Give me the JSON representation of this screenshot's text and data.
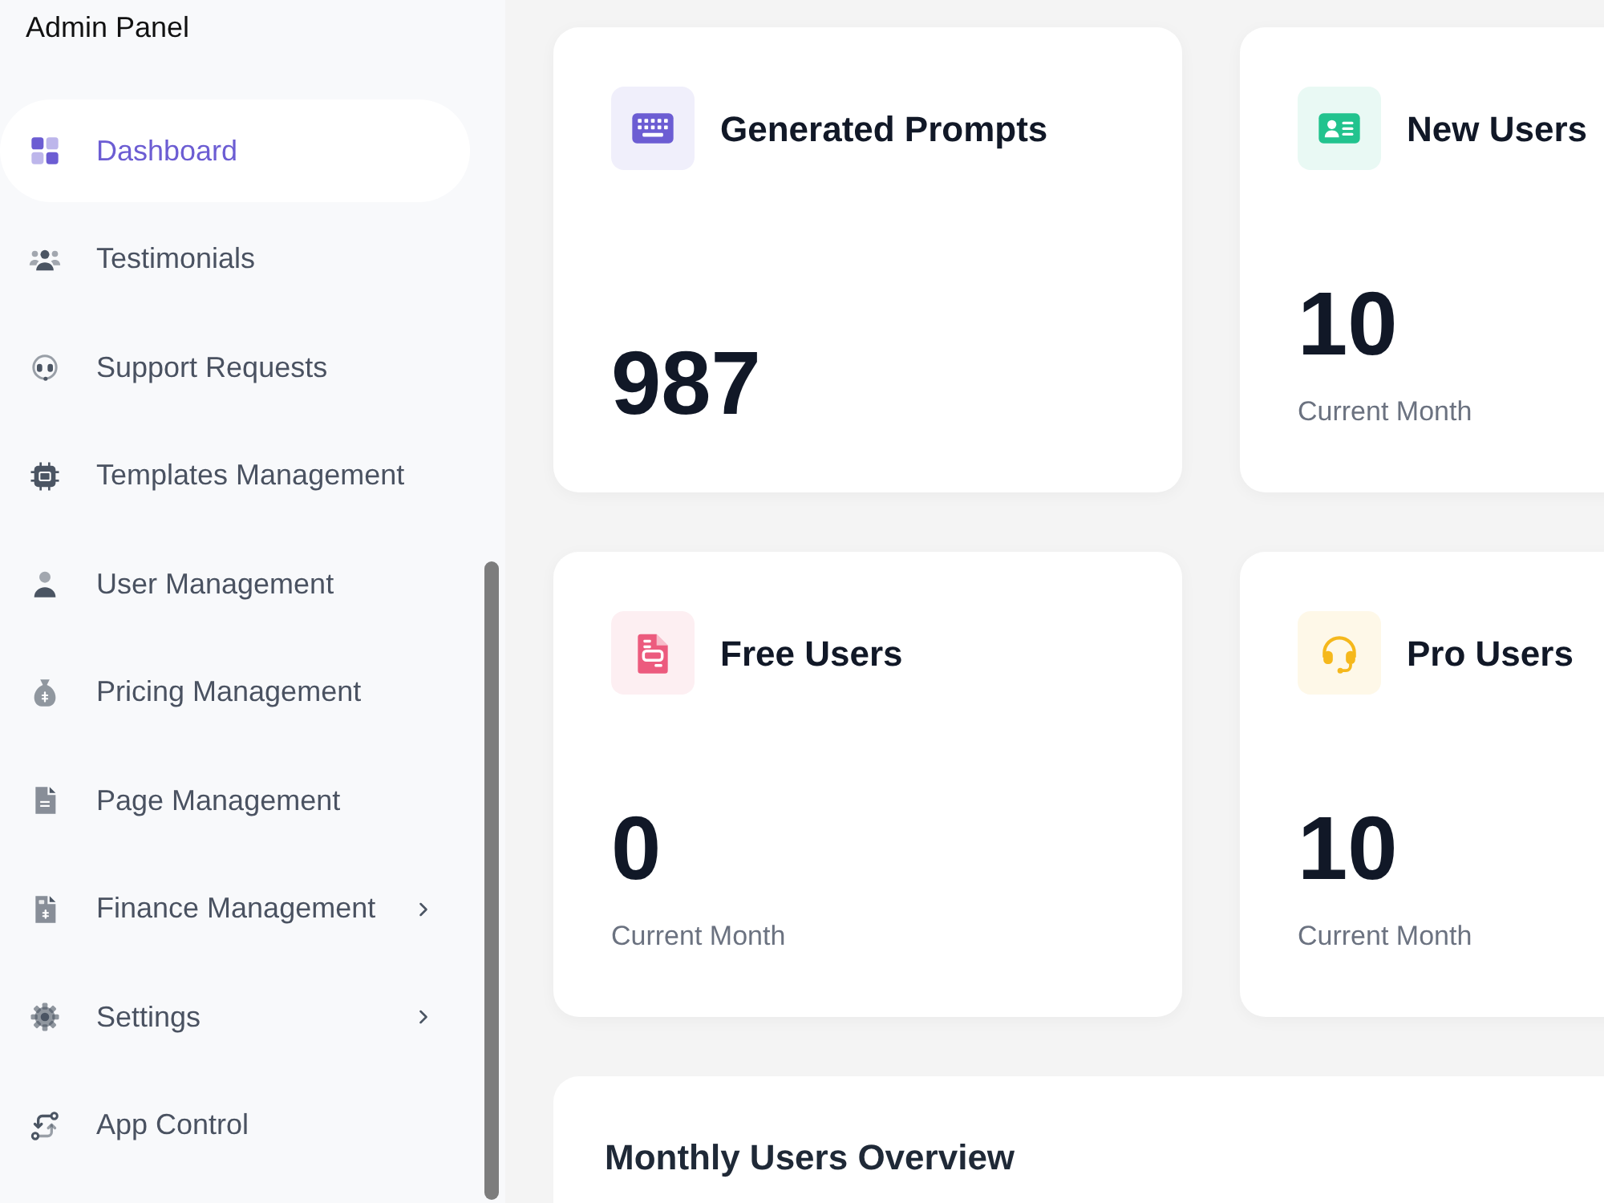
{
  "sidebar": {
    "title": "Admin Panel",
    "items": [
      {
        "label": "Dashboard",
        "kind": "link",
        "selected": true
      },
      {
        "label": "Testimonials",
        "kind": "link",
        "selected": false
      },
      {
        "label": "Support Requests",
        "kind": "link",
        "selected": false
      },
      {
        "label": "Templates Management",
        "kind": "link",
        "selected": false
      },
      {
        "label": "User Management",
        "kind": "link",
        "selected": false
      },
      {
        "label": "Pricing Management",
        "kind": "link",
        "selected": false
      },
      {
        "label": "Page Management",
        "kind": "link",
        "selected": false
      },
      {
        "label": "Finance Management",
        "kind": "submenu",
        "selected": false
      },
      {
        "label": "Settings",
        "kind": "submenu",
        "selected": false
      },
      {
        "label": "App Control",
        "kind": "link",
        "selected": false
      }
    ]
  },
  "stat_cards": [
    {
      "title": "Generated Prompts",
      "value": "987",
      "color": "#6c5dd3"
    },
    {
      "title": "New Users",
      "value": "10",
      "subtitle": "Current Month",
      "color": "#22c38e"
    },
    {
      "title": "Free Users",
      "value": "0",
      "subtitle": "Current Month",
      "color": "#ec5b7e"
    },
    {
      "title": "Pro Users",
      "value": "10",
      "subtitle": "Current Month",
      "color": "#f5b81c"
    }
  ],
  "overview_panel": {
    "title": "Monthly Users Overview"
  }
}
